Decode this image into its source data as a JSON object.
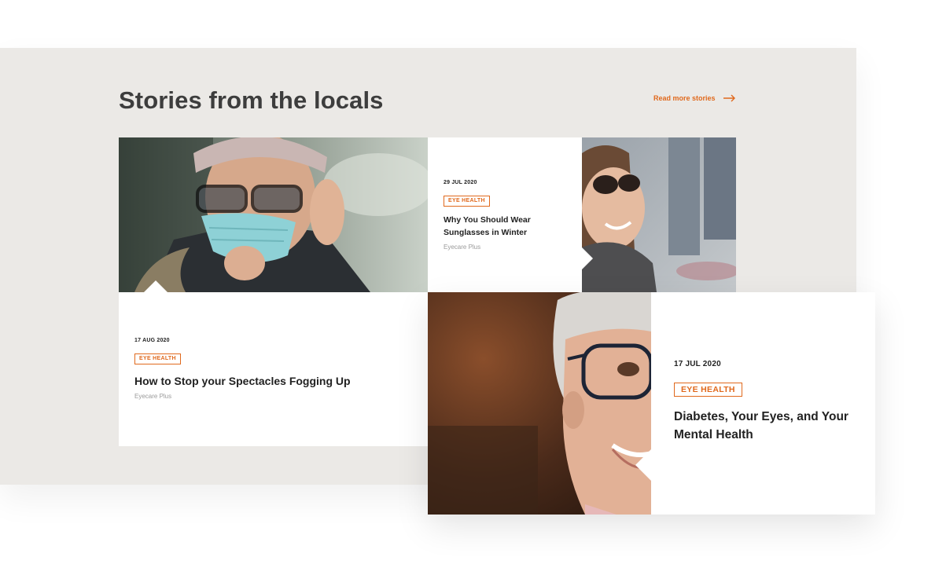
{
  "section": {
    "title": "Stories from the locals",
    "read_more": "Read more stories",
    "accent": "#e0691d",
    "background": "#ebe9e6"
  },
  "stories": [
    {
      "date": "17 AUG 2020",
      "tag": "EYE HEALTH",
      "title": "How to Stop your Spectacles Fogging Up",
      "author": "Eyecare Plus",
      "image": "woman-foggy-glasses-face-mask-photo"
    },
    {
      "date": "29 JUL 2020",
      "tag": "EYE HEALTH",
      "title": "Why You Should Wear Sunglasses in Winter",
      "author": "Eyecare Plus",
      "image": "smiling-woman-sunglasses-photo"
    },
    {
      "date": "17 JUL 2020",
      "tag": "EYE HEALTH",
      "title": "Diabetes, Your Eyes, and Your Mental Health",
      "image": "senior-woman-glasses-photo"
    }
  ]
}
